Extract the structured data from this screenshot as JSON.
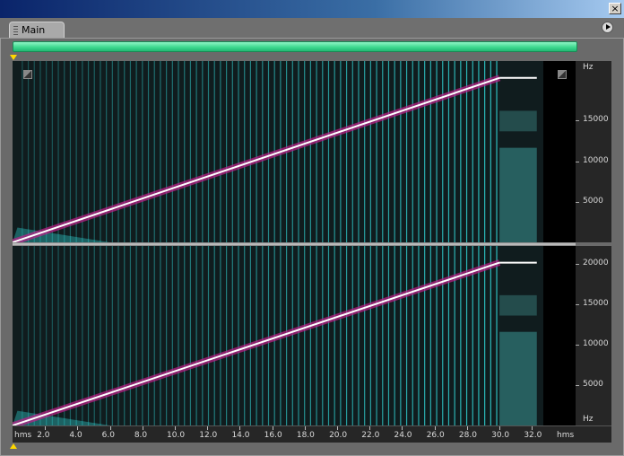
{
  "window": {
    "close_glyph": "×"
  },
  "tabs": [
    {
      "label": "Main",
      "active": true
    }
  ],
  "icons": {
    "panel_menu": "play-circle-icon",
    "close": "close-icon",
    "tab_grip": "grip-icon",
    "display_toggle_left": "display-toggle-icon",
    "display_toggle_right": "display-toggle-icon"
  },
  "colors": {
    "overview_bar": "#3fd98f",
    "spectrum_background": "#101c1e",
    "harmonic": "#35e6e6",
    "sweep_core": "#ffffff",
    "sweep_fringe": "#c0208a",
    "marker": "#ffd800"
  },
  "frequency_ruler": {
    "unit": "Hz",
    "top_channel_ticks": [
      "15000",
      "10000",
      "5000"
    ],
    "bottom_channel_ticks": [
      "20000",
      "15000",
      "10000",
      "5000"
    ]
  },
  "time_ruler": {
    "unit_start": "hms",
    "unit_end": "hms",
    "ticks": [
      "2.0",
      "4.0",
      "6.0",
      "8.0",
      "10.0",
      "12.0",
      "14.0",
      "16.0",
      "18.0",
      "20.0",
      "22.0",
      "24.0",
      "26.0",
      "28.0",
      "30.0",
      "32.0"
    ]
  },
  "chart_data": {
    "type": "spectrogram",
    "channels": 2,
    "x_unit": "s",
    "y_unit": "Hz",
    "xlim": [
      0,
      32.7
    ],
    "ylim": [
      0,
      22050
    ],
    "sweep": {
      "start": [
        0,
        0
      ],
      "end": [
        30,
        20000
      ]
    },
    "plateau_end_time": 32.3,
    "residual_block_start": 30.0
  }
}
